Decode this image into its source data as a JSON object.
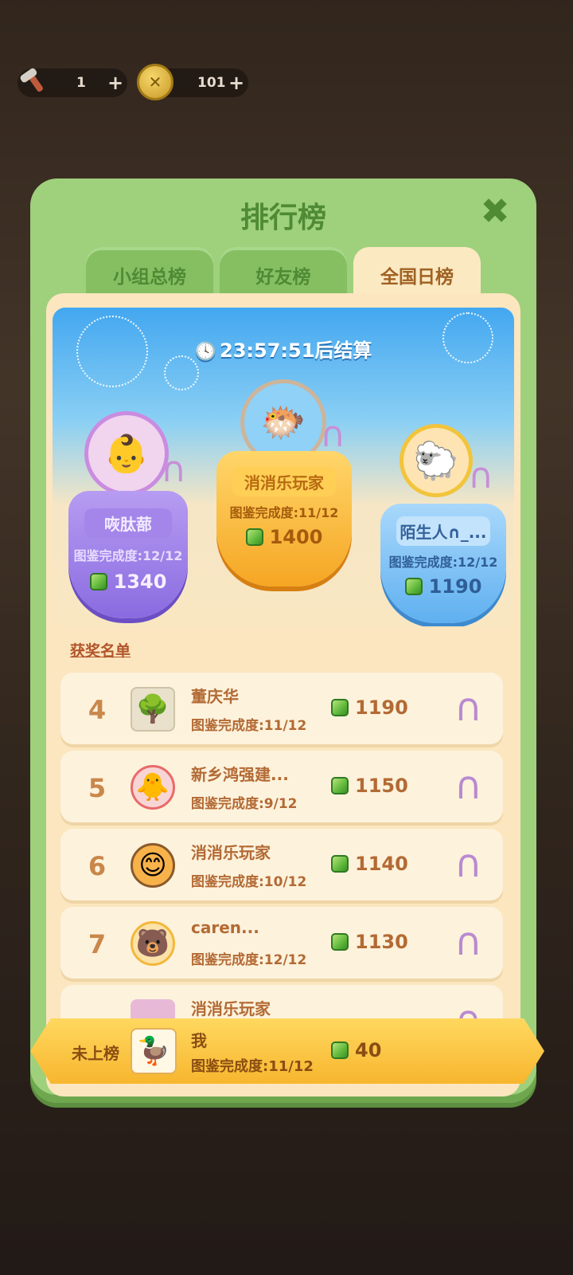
{
  "resources": {
    "hammer": {
      "count": "1",
      "plus": "+",
      "icon": "hammer-icon"
    },
    "coins": {
      "count": "101",
      "plus": "+",
      "icon": "coin-icon"
    }
  },
  "panel": {
    "title": "排行榜",
    "close_icon": "close-icon",
    "tabs": [
      {
        "label": "小组总榜",
        "active": false
      },
      {
        "label": "好友榜",
        "active": false
      },
      {
        "label": "全国日榜",
        "active": true
      }
    ]
  },
  "timer": {
    "value": "23:57:51",
    "suffix": "后结算"
  },
  "podium": {
    "first": {
      "name": "消消乐玩家",
      "completion": "图鉴完成度:11/12",
      "score": "1400"
    },
    "second": {
      "name": "咴肽蔀",
      "completion": "图鉴完成度:12/12",
      "score": "1340"
    },
    "third": {
      "name": "陌生人∩_...",
      "completion": "图鉴完成度:12/12",
      "score": "1190"
    }
  },
  "winners_label": "获奖名单",
  "list": [
    {
      "rank": "4",
      "name": "董庆华",
      "completion": "图鉴完成度:11/12",
      "score": "1190"
    },
    {
      "rank": "5",
      "name": "新乡鸿强建...",
      "completion": "图鉴完成度:9/12",
      "score": "1150"
    },
    {
      "rank": "6",
      "name": "消消乐玩家",
      "completion": "图鉴完成度:10/12",
      "score": "1140"
    },
    {
      "rank": "7",
      "name": "caren...",
      "completion": "图鉴完成度:12/12",
      "score": "1130"
    },
    {
      "rank": "",
      "name": "消消乐玩家",
      "completion": "",
      "score": ""
    }
  ],
  "me": {
    "rank_label": "未上榜",
    "name": "我",
    "completion": "图鉴完成度:11/12",
    "score": "40"
  },
  "colors": {
    "panel_green": "#9fd07c",
    "tab_active": "#fbe9c2",
    "score_brown": "#b36a34",
    "me_bar": "#f7b62e"
  }
}
